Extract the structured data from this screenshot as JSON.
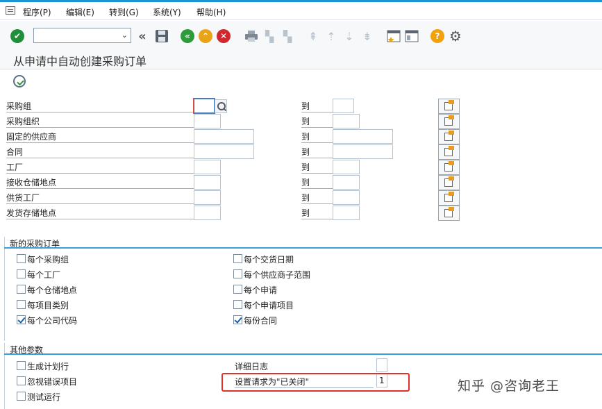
{
  "menu": {
    "items": [
      {
        "label": "程序(P)"
      },
      {
        "label": "编辑(E)"
      },
      {
        "label": "转到(G)"
      },
      {
        "label": "系统(Y)"
      },
      {
        "label": "帮助(H)"
      }
    ]
  },
  "title": "从申请中自动创建采购订单",
  "selection": {
    "to_label": "到",
    "rows": [
      {
        "label": "采购组"
      },
      {
        "label": "采购组织"
      },
      {
        "label": "固定的供应商"
      },
      {
        "label": "合同"
      },
      {
        "label": "工厂"
      },
      {
        "label": "接收仓储地点"
      },
      {
        "label": "供货工厂"
      },
      {
        "label": "发货存储地点"
      }
    ]
  },
  "new_po": {
    "title": "新的采购订单",
    "left": [
      {
        "label": "每个采购组",
        "checked": false
      },
      {
        "label": "每个工厂",
        "checked": false
      },
      {
        "label": "每个仓储地点",
        "checked": false
      },
      {
        "label": "每项目类别",
        "checked": false
      },
      {
        "label": "每个公司代码",
        "checked": true
      }
    ],
    "right": [
      {
        "label": "每个交货日期",
        "checked": false
      },
      {
        "label": "每个供应商子范围",
        "checked": false
      },
      {
        "label": "每个申请",
        "checked": false
      },
      {
        "label": "每个申请项目",
        "checked": false
      },
      {
        "label": "每份合同",
        "checked": true
      }
    ]
  },
  "other": {
    "title": "其他参数",
    "left": [
      {
        "label": "生成计划行",
        "checked": false
      },
      {
        "label": "忽视错误项目",
        "checked": false
      },
      {
        "label": "测试运行",
        "checked": false
      }
    ],
    "detail_log_label": "详细日志",
    "detail_log_value": "",
    "set_closed_label": "设置请求为\"已关闭\"",
    "set_closed_value": "1"
  },
  "watermark": "知乎 @咨询老王",
  "colors": {
    "accent": "#1d95d2",
    "enter_green": "#1f8f3a",
    "back_green": "#2e9b3b",
    "exit_yellow": "#e8a317",
    "cancel_red": "#d0282d",
    "help_yellow": "#f0a10c",
    "highlight_red": "#e0302a"
  }
}
